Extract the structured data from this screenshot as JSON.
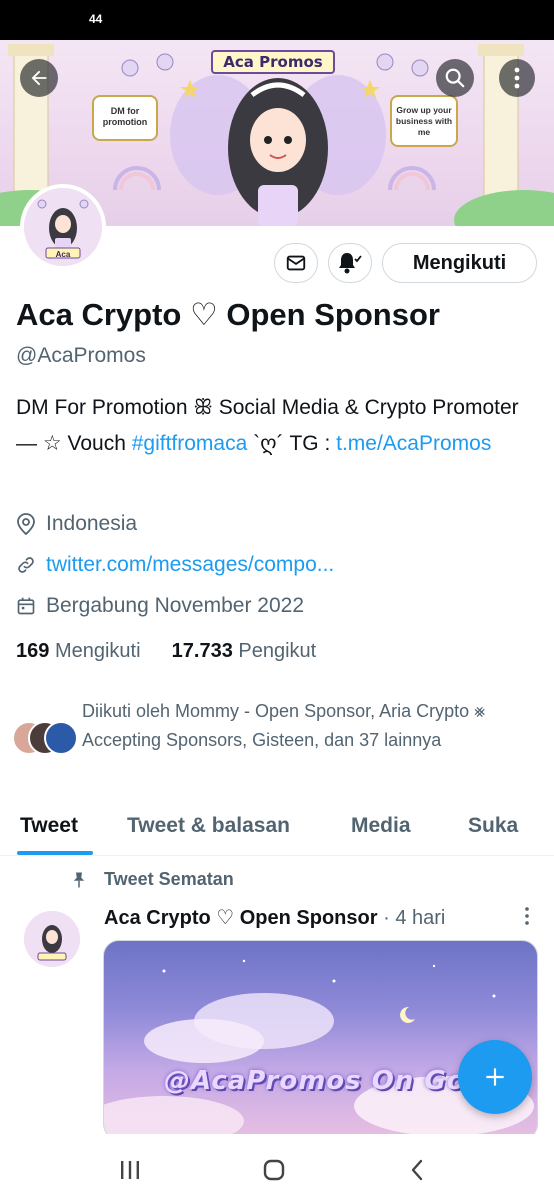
{
  "status_bar": {
    "time": "44"
  },
  "banner": {
    "title": "Aca Promos",
    "left_sign": "DM for promotion",
    "right_sign": "Grow up your business with me"
  },
  "avatar": {
    "label": "Aca"
  },
  "actions": {
    "follow_label": "Mengikuti"
  },
  "profile": {
    "display_name": "Aca Crypto ♡ Open Sponsor",
    "handle": "@AcaPromos",
    "bio": {
      "part1": "DM For Promotion ꕥ Social Media & Crypto Promoter  — ☆ Vouch ",
      "hashtag": "#giftfromaca",
      "part2": " `ღ´ TG : ",
      "link": "t.me/AcaPromos"
    },
    "location": "Indonesia",
    "website": "twitter.com/messages/compo...",
    "joined": "Bergabung November 2022"
  },
  "stats": {
    "following_count": "169",
    "following_label": "Mengikuti",
    "followers_count": "17.733",
    "followers_label": "Pengikut"
  },
  "followed_by": "Diikuti oleh Mommy - Open Sponsor, Aria Crypto ⨳ Accepting Sponsors, Gisteen, dan 37 lainnya",
  "tabs": [
    "Tweet",
    "Tweet & balasan",
    "Media",
    "Suka"
  ],
  "pinned_tweet": {
    "pinned_label": "Tweet Sematan",
    "author": "Aca Crypto ♡ Open Sponsor",
    "separator": "·",
    "time": "4 hari",
    "media_text": "@AcaPromos On Goin"
  },
  "colors": {
    "accent": "#1d9bf0",
    "text_primary": "#0f1419",
    "text_secondary": "#536471",
    "border": "#cfd9de"
  }
}
